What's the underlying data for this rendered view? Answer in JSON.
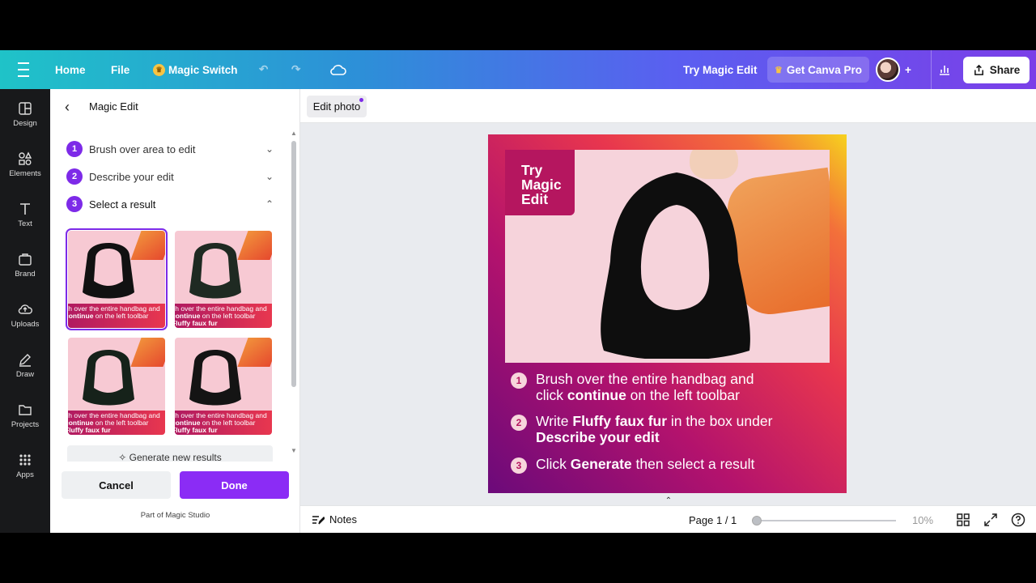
{
  "topbar": {
    "home": "Home",
    "file": "File",
    "magic_switch": "Magic Switch",
    "try_magic_edit": "Try Magic Edit",
    "get_pro": "Get Canva Pro",
    "share": "Share",
    "accent": "#7d2ae8"
  },
  "rail": {
    "items": [
      {
        "label": "Design",
        "icon": "design-icon"
      },
      {
        "label": "Elements",
        "icon": "elements-icon"
      },
      {
        "label": "Text",
        "icon": "text-icon"
      },
      {
        "label": "Brand",
        "icon": "brand-icon"
      },
      {
        "label": "Uploads",
        "icon": "uploads-icon"
      },
      {
        "label": "Draw",
        "icon": "draw-icon"
      },
      {
        "label": "Projects",
        "icon": "projects-icon"
      },
      {
        "label": "Apps",
        "icon": "apps-icon"
      }
    ]
  },
  "panel": {
    "title": "Magic Edit",
    "steps": [
      {
        "num": "1",
        "label": "Brush over area to edit"
      },
      {
        "num": "2",
        "label": "Describe your edit"
      },
      {
        "num": "3",
        "label": "Select a result"
      }
    ],
    "result_caption_1": "sh over the entire handbag and",
    "result_caption_2": "continue",
    "result_caption_2b": " on the left toolbar",
    "result_caption_3": "Fluffy faux fur",
    "generate": "Generate new results",
    "cancel": "Cancel",
    "done": "Done",
    "studio": "Part of Magic Studio"
  },
  "editor": {
    "edit_photo": "Edit photo",
    "tag_line1": "Try",
    "tag_line2": "Magic",
    "tag_line3": "Edit",
    "inst1_num": "1",
    "inst1_a": "Brush over the entire handbag and",
    "inst1_b": "click ",
    "inst1_bold": "continue",
    "inst1_c": " on the left toolbar",
    "inst2_num": "2",
    "inst2_a": "Write ",
    "inst2_bold": "Fluffy faux fur",
    "inst2_b": " in the box under",
    "inst2_bold2": "Describe your edit",
    "inst3_num": "3",
    "inst3_a": "Click ",
    "inst3_bold": "Generate",
    "inst3_b": " then select a result",
    "notes": "Notes",
    "page": "Page 1 / 1",
    "zoom": "10%"
  }
}
